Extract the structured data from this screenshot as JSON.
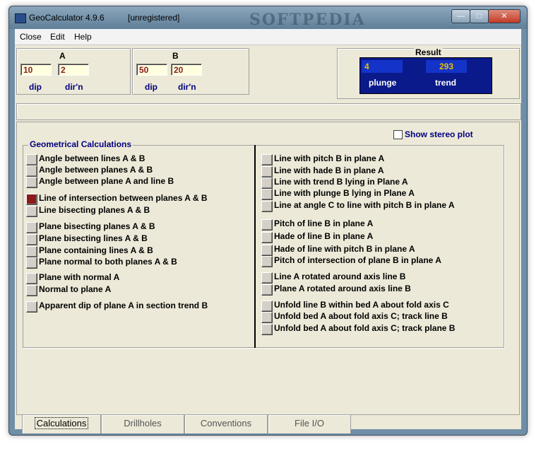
{
  "window": {
    "title": "GeoCalculator 4.9.6",
    "registration": "[unregistered]",
    "watermark": "SOFTPEDIA"
  },
  "menu": [
    "Close",
    "Edit",
    "Help"
  ],
  "lineA": {
    "label": "A",
    "dip": "10",
    "dirn": "2",
    "dip_label": "dip",
    "dirn_label": "dir'n"
  },
  "lineB": {
    "label": "B",
    "dip": "50",
    "dirn": "20",
    "dip_label": "dip",
    "dirn_label": "dir'n"
  },
  "result": {
    "label": "Result",
    "plunge": "4",
    "trend": "293",
    "plunge_label": "plunge",
    "trend_label": "trend"
  },
  "stereo": {
    "label": "Show stereo plot",
    "checked": false
  },
  "group_title": "Geometrical Calculations",
  "left_calcs": [
    "Angle between lines A & B",
    "Angle between planes A & B",
    "Angle between plane A and line B",
    "Line of intersection between planes A & B",
    "Line bisecting planes A & B",
    "Plane bisecting planes A & B",
    "Plane bisecting lines A & B",
    "Plane containing lines A & B",
    "Plane normal to both planes A & B",
    "Plane with normal A",
    "Normal to plane A",
    "Apparent dip of plane A in section trend B"
  ],
  "right_calcs": [
    "Line with pitch B in plane A",
    "Line with hade B in plane A",
    "Line with trend B lying in Plane A",
    "Line with plunge B lying in Plane A",
    "Line at angle C to line with pitch B in plane A",
    "Pitch of line B in plane A",
    "Hade of line B in plane A",
    "Hade of line with pitch B in plane A",
    "Pitch of intersection of plane B in plane A",
    "Line A rotated around axis line B",
    "Plane A rotated around axis line B",
    "Unfold line B within bed A about fold axis C",
    "Unfold bed A about fold axis C; track line B",
    "Unfold bed A about fold axis C; track plane B"
  ],
  "tabs": [
    "Calculations",
    "Drillholes",
    "Conventions",
    "File I/O"
  ],
  "active_tab": "Calculations",
  "active_calc": "Line of intersection between planes A & B"
}
